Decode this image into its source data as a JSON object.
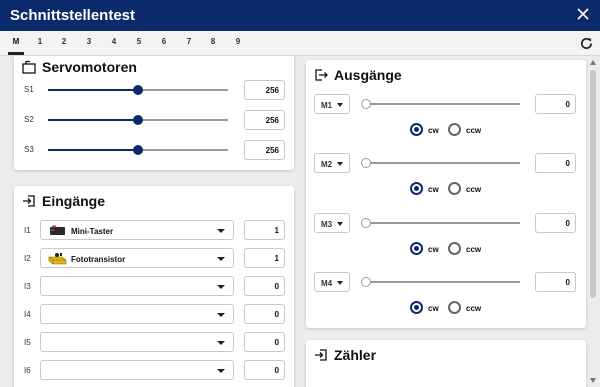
{
  "window": {
    "title": "Schnittstellentest"
  },
  "tabs": [
    "M",
    "1",
    "2",
    "3",
    "4",
    "5",
    "6",
    "7",
    "8",
    "9"
  ],
  "servos": {
    "title": "Servomotoren",
    "rows": [
      {
        "label": "S1",
        "value": "256",
        "level": 0.5
      },
      {
        "label": "S2",
        "value": "256",
        "level": 0.5
      },
      {
        "label": "S3",
        "value": "256",
        "level": 0.5
      }
    ]
  },
  "inputs": {
    "title": "Eingänge",
    "rows": [
      {
        "label": "I1",
        "device": "Mini-Taster",
        "icon": "mini-switch-icon",
        "value": "1"
      },
      {
        "label": "I2",
        "device": "Fototransistor",
        "icon": "phototransistor-icon",
        "value": "1"
      },
      {
        "label": "I3",
        "device": "",
        "icon": "",
        "value": "0"
      },
      {
        "label": "I4",
        "device": "",
        "icon": "",
        "value": "0"
      },
      {
        "label": "I5",
        "device": "",
        "icon": "",
        "value": "0"
      },
      {
        "label": "I6",
        "device": "",
        "icon": "",
        "value": "0"
      }
    ]
  },
  "outputs": {
    "title": "Ausgänge",
    "cw_label": "cw",
    "ccw_label": "ccw",
    "rows": [
      {
        "label": "M1",
        "value": "0",
        "level": 0,
        "direction": "cw"
      },
      {
        "label": "M2",
        "value": "0",
        "level": 0,
        "direction": "cw"
      },
      {
        "label": "M3",
        "value": "0",
        "level": 0,
        "direction": "cw"
      },
      {
        "label": "M4",
        "value": "0",
        "level": 0,
        "direction": "cw"
      }
    ]
  },
  "counters": {
    "title": "Zähler"
  },
  "colors": {
    "titlebar": "#0a2a6b",
    "accent": "#0a2a6b"
  }
}
